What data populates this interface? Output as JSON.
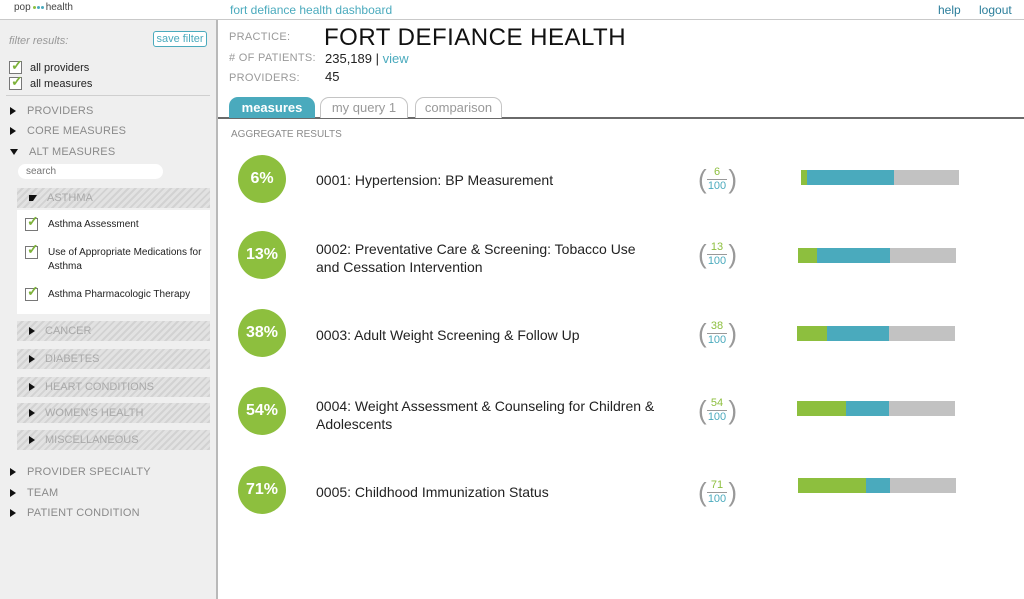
{
  "topbar": {
    "logo_left": "pop",
    "logo_right": "health",
    "app_title": "fort defiance health dashboard",
    "help": "help",
    "logout": "logout"
  },
  "sidebar": {
    "filter_label": "filter results:",
    "save_filter": "save filter",
    "checks": [
      "all providers",
      "all measures"
    ],
    "sections_top": [
      {
        "label": "PROVIDERS",
        "expanded": false
      },
      {
        "label": "CORE MEASURES",
        "expanded": false
      },
      {
        "label": "ALT MEASURES",
        "expanded": true
      }
    ],
    "search_placeholder": "search",
    "categories": [
      {
        "label": "ASTHMA",
        "expanded": true
      },
      {
        "label": "CANCER",
        "expanded": false
      },
      {
        "label": "DIABETES",
        "expanded": false
      },
      {
        "label": "HEART CONDITIONS",
        "expanded": false
      },
      {
        "label": "WOMEN'S HEALTH",
        "expanded": false
      },
      {
        "label": "MISCELLANEOUS",
        "expanded": false
      }
    ],
    "asthma_items": [
      "Asthma Assessment",
      "Use of Appropriate Medications for Asthma",
      "Asthma Pharmacologic Therapy"
    ],
    "sections_bottom": [
      {
        "label": "PROVIDER SPECIALTY",
        "expanded": false
      },
      {
        "label": "TEAM",
        "expanded": false
      },
      {
        "label": "PATIENT CONDITION",
        "expanded": false
      }
    ]
  },
  "info": {
    "practice_label": "PRACTICE:",
    "practice_name": "FORT DEFIANCE HEALTH",
    "patients_label": "# OF PATIENTS:",
    "patients_value": "235,189",
    "patients_sep": "|",
    "patients_link": "view",
    "providers_label": "PROVIDERS:",
    "providers_value": "45"
  },
  "tabs": [
    "measures",
    "my query 1",
    "comparison"
  ],
  "active_tab": "measures",
  "section_title": "AGGREGATE RESULTS",
  "measures": [
    {
      "pct": "6%",
      "name": "0001: Hypertension: BP Measurement",
      "num": "6",
      "den": "100",
      "green_frac": 0.04,
      "blue_frac": 0.55
    },
    {
      "pct": "13%",
      "name": "0002: Preventative Care & Screening: Tobacco Use and Cessation Intervention",
      "num": "13",
      "den": "100",
      "green_frac": 0.12,
      "blue_frac": 0.46
    },
    {
      "pct": "38%",
      "name": "0003: Adult Weight Screening & Follow Up",
      "num": "38",
      "den": "100",
      "green_frac": 0.19,
      "blue_frac": 0.39
    },
    {
      "pct": "54%",
      "name": " 0004: Weight Assessment & Counseling for Children & Adolescents",
      "num": "54",
      "den": "100",
      "green_frac": 0.31,
      "blue_frac": 0.27
    },
    {
      "pct": "71%",
      "name": "0005:  Childhood Immunization Status",
      "num": "71",
      "den": "100",
      "green_frac": 0.43,
      "blue_frac": 0.15
    }
  ],
  "colors": {
    "accent_blue": "#4aaabd",
    "accent_green": "#8dbf3e",
    "bar_gray": "#c2c2c2"
  }
}
